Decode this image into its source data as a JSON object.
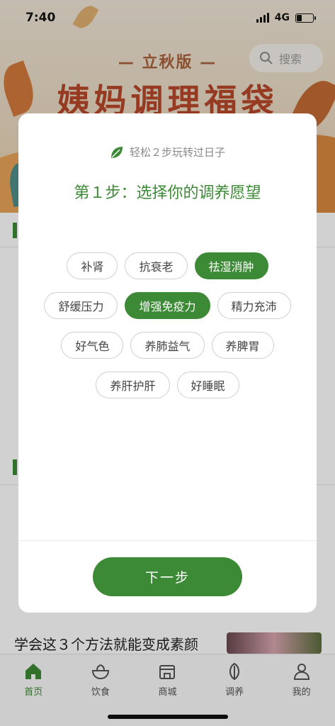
{
  "status_bar": {
    "time": "7:40",
    "network": "4G"
  },
  "banner": {
    "subtitle": "— 立秋版 —",
    "title": "姨妈调理福袋"
  },
  "search": {
    "placeholder": "搜索"
  },
  "background": {
    "article_title": "学会这３个方法就能变成素颜"
  },
  "modal": {
    "hint": "轻松２步玩转过日子",
    "step_title": "第１步：选择你的调养愿望",
    "tags": [
      {
        "label": "补肾",
        "selected": false
      },
      {
        "label": "抗衰老",
        "selected": false
      },
      {
        "label": "祛湿消肿",
        "selected": true
      },
      {
        "label": "舒缓压力",
        "selected": false
      },
      {
        "label": "增强免疫力",
        "selected": true
      },
      {
        "label": "精力充沛",
        "selected": false
      },
      {
        "label": "好气色",
        "selected": false
      },
      {
        "label": "养肺益气",
        "selected": false
      },
      {
        "label": "养脾胃",
        "selected": false
      },
      {
        "label": "养肝护肝",
        "selected": false
      },
      {
        "label": "好睡眠",
        "selected": false
      }
    ],
    "next_button": "下一步"
  },
  "tabbar": {
    "items": [
      {
        "label": "首页",
        "icon": "home-icon",
        "active": true
      },
      {
        "label": "饮食",
        "icon": "bowl-icon",
        "active": false
      },
      {
        "label": "商城",
        "icon": "store-icon",
        "active": false
      },
      {
        "label": "调养",
        "icon": "leaf-icon",
        "active": false
      },
      {
        "label": "我的",
        "icon": "person-icon",
        "active": false
      }
    ]
  },
  "colors": {
    "accent": "#3d8a36",
    "banner_title": "#b7472a"
  }
}
